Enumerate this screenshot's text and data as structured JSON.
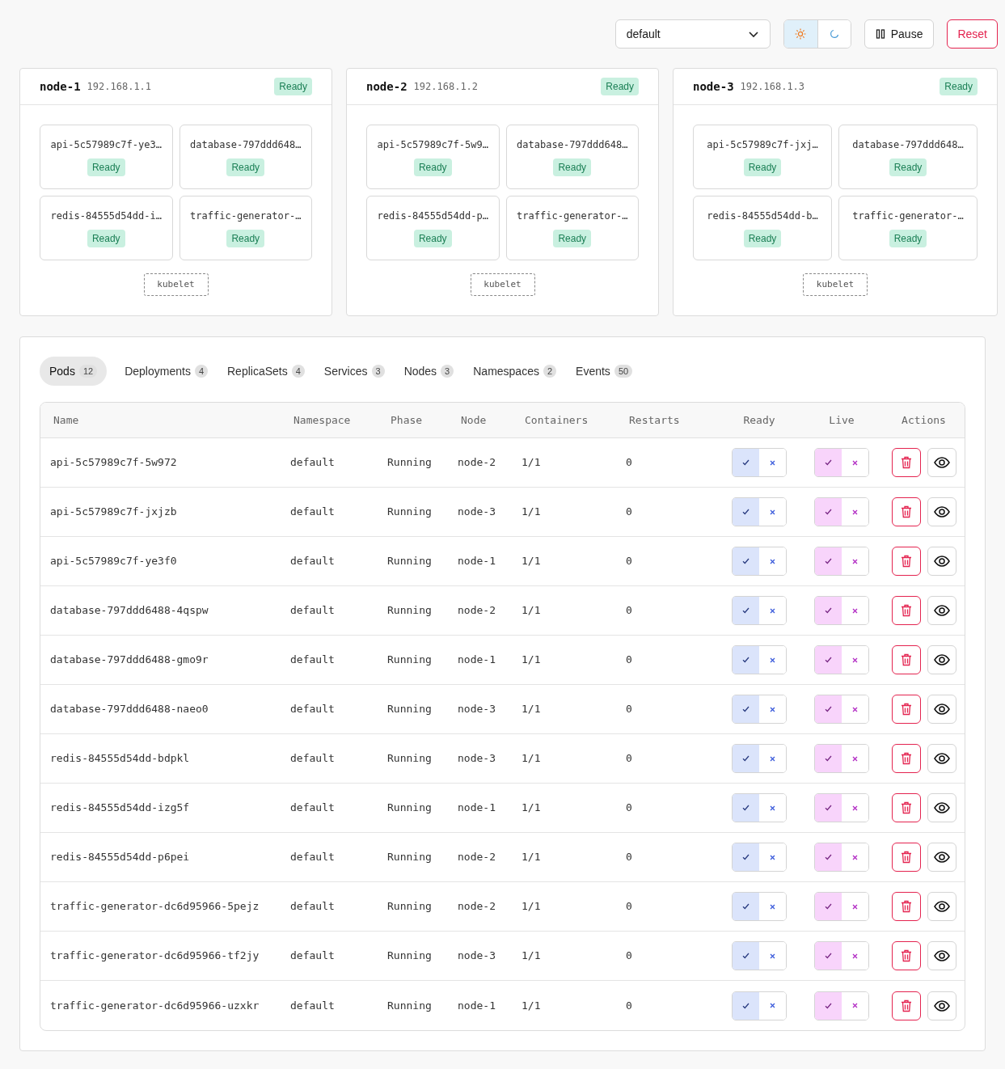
{
  "toolbar": {
    "namespace_select": "default",
    "theme": [
      {
        "kind": "light",
        "selected": true
      },
      {
        "kind": "dark",
        "selected": false
      }
    ],
    "pause_button": "Pause",
    "reset_button": "Reset"
  },
  "nodes": [
    {
      "name": "node-1",
      "ip": "192.168.1.1",
      "status": "Ready",
      "pods": [
        {
          "name": "api-5c57989c7f-ye3…",
          "status": "Ready"
        },
        {
          "name": "database-797ddd648…",
          "status": "Ready"
        },
        {
          "name": "redis-84555d54dd-i…",
          "status": "Ready"
        },
        {
          "name": "traffic-generator-…",
          "status": "Ready"
        }
      ],
      "kubelet": "kubelet"
    },
    {
      "name": "node-2",
      "ip": "192.168.1.2",
      "status": "Ready",
      "pods": [
        {
          "name": "api-5c57989c7f-5w9…",
          "status": "Ready"
        },
        {
          "name": "database-797ddd648…",
          "status": "Ready"
        },
        {
          "name": "redis-84555d54dd-p…",
          "status": "Ready"
        },
        {
          "name": "traffic-generator-…",
          "status": "Ready"
        }
      ],
      "kubelet": "kubelet"
    },
    {
      "name": "node-3",
      "ip": "192.168.1.3",
      "status": "Ready",
      "pods": [
        {
          "name": "api-5c57989c7f-jxj…",
          "status": "Ready"
        },
        {
          "name": "database-797ddd648…",
          "status": "Ready"
        },
        {
          "name": "redis-84555d54dd-b…",
          "status": "Ready"
        },
        {
          "name": "traffic-generator-…",
          "status": "Ready"
        }
      ],
      "kubelet": "kubelet"
    }
  ],
  "tabs": [
    {
      "label": "Pods",
      "count": "12",
      "selected": true
    },
    {
      "label": "Deployments",
      "count": "4",
      "selected": false
    },
    {
      "label": "ReplicaSets",
      "count": "4",
      "selected": false
    },
    {
      "label": "Services",
      "count": "3",
      "selected": false
    },
    {
      "label": "Nodes",
      "count": "3",
      "selected": false
    },
    {
      "label": "Namespaces",
      "count": "2",
      "selected": false
    },
    {
      "label": "Events",
      "count": "50",
      "selected": false
    }
  ],
  "table": {
    "columns": [
      "Name",
      "Namespace",
      "Phase",
      "Node",
      "Containers",
      "Restarts",
      "Ready",
      "Live",
      "Actions"
    ],
    "rows": [
      {
        "name": "api-5c57989c7f-5w972",
        "namespace": "default",
        "phase": "Running",
        "node": "node-2",
        "containers": "1/1",
        "restarts": "0",
        "ready": true,
        "live": true
      },
      {
        "name": "api-5c57989c7f-jxjzb",
        "namespace": "default",
        "phase": "Running",
        "node": "node-3",
        "containers": "1/1",
        "restarts": "0",
        "ready": true,
        "live": true
      },
      {
        "name": "api-5c57989c7f-ye3f0",
        "namespace": "default",
        "phase": "Running",
        "node": "node-1",
        "containers": "1/1",
        "restarts": "0",
        "ready": true,
        "live": true
      },
      {
        "name": "database-797ddd6488-4qspw",
        "namespace": "default",
        "phase": "Running",
        "node": "node-2",
        "containers": "1/1",
        "restarts": "0",
        "ready": true,
        "live": true
      },
      {
        "name": "database-797ddd6488-gmo9r",
        "namespace": "default",
        "phase": "Running",
        "node": "node-1",
        "containers": "1/1",
        "restarts": "0",
        "ready": true,
        "live": true
      },
      {
        "name": "database-797ddd6488-naeo0",
        "namespace": "default",
        "phase": "Running",
        "node": "node-3",
        "containers": "1/1",
        "restarts": "0",
        "ready": true,
        "live": true
      },
      {
        "name": "redis-84555d54dd-bdpkl",
        "namespace": "default",
        "phase": "Running",
        "node": "node-3",
        "containers": "1/1",
        "restarts": "0",
        "ready": true,
        "live": true
      },
      {
        "name": "redis-84555d54dd-izg5f",
        "namespace": "default",
        "phase": "Running",
        "node": "node-1",
        "containers": "1/1",
        "restarts": "0",
        "ready": true,
        "live": true
      },
      {
        "name": "redis-84555d54dd-p6pei",
        "namespace": "default",
        "phase": "Running",
        "node": "node-2",
        "containers": "1/1",
        "restarts": "0",
        "ready": true,
        "live": true
      },
      {
        "name": "traffic-generator-dc6d95966-5pejz",
        "namespace": "default",
        "phase": "Running",
        "node": "node-2",
        "containers": "1/1",
        "restarts": "0",
        "ready": true,
        "live": true
      },
      {
        "name": "traffic-generator-dc6d95966-tf2jy",
        "namespace": "default",
        "phase": "Running",
        "node": "node-3",
        "containers": "1/1",
        "restarts": "0",
        "ready": true,
        "live": true
      },
      {
        "name": "traffic-generator-dc6d95966-uzxkr",
        "namespace": "default",
        "phase": "Running",
        "node": "node-1",
        "containers": "1/1",
        "restarts": "0",
        "ready": true,
        "live": true
      }
    ]
  }
}
